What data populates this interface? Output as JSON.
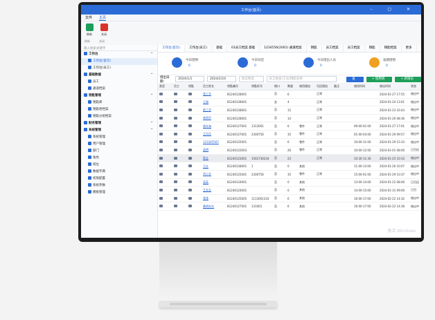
{
  "window": {
    "title": "工作台(首页)",
    "controls": "–  ▢  ✕"
  },
  "menu": [
    "文件",
    "主页"
  ],
  "ribbon": {
    "refresh": "刷新",
    "close": "关闭",
    "group1": "刷新",
    "group2": "关闭"
  },
  "sidebar": {
    "search": "输入搜索关键字",
    "items": [
      {
        "label": "工作台",
        "type": "head"
      },
      {
        "label": "工作台(首页)",
        "type": "sub",
        "selected": true
      },
      {
        "label": "工作台(员工)",
        "type": "sub"
      },
      {
        "label": "基础数据",
        "type": "head"
      },
      {
        "label": "员工",
        "type": "sub"
      },
      {
        "label": "通道档案",
        "type": "sub"
      },
      {
        "label": "钥匙管理",
        "type": "head"
      },
      {
        "label": "钥匙库",
        "type": "sub"
      },
      {
        "label": "钥匙柜档案",
        "type": "sub"
      },
      {
        "label": "钥匙分组档案",
        "type": "sub"
      },
      {
        "label": "财务管理",
        "type": "head"
      },
      {
        "label": "系统管理",
        "type": "head"
      },
      {
        "label": "系统管理",
        "type": "sub"
      },
      {
        "label": "用户管理",
        "type": "sub"
      },
      {
        "label": "部门",
        "type": "sub"
      },
      {
        "label": "角色",
        "type": "sub"
      },
      {
        "label": "岗位",
        "type": "sub"
      },
      {
        "label": "数据字典",
        "type": "sub"
      },
      {
        "label": "权限配置",
        "type": "sub"
      },
      {
        "label": "系统参数",
        "type": "sub"
      },
      {
        "label": "模板管理",
        "type": "sub"
      }
    ]
  },
  "tabs": [
    "工作台(首页)",
    "工作台(员工)",
    "基础",
    "01员工档案 基础",
    "1234556(2001) 通道档案",
    "钥匙",
    "员工档案",
    "员工档案",
    "钥匙",
    "钥匙档案",
    "更多"
  ],
  "stats": [
    {
      "label": "今日借钥",
      "value": "6",
      "color": "#2b6bd6"
    },
    {
      "label": "今日归还",
      "value": "0",
      "color": "#2b6bd6"
    },
    {
      "label": "今日借出人员",
      "value": "0",
      "color": "#2b6bd6"
    },
    {
      "label": "逾期借钥",
      "value": "0",
      "color": "#f0a020"
    }
  ],
  "filter": {
    "label": "借出日期:",
    "from": "2024/1/1",
    "to": "2024/2/24",
    "status_ph": "状态筛选",
    "search_ph": "员工姓名/工号/钥匙名称",
    "query": "查询",
    "borrow": "+ 借用钥匙",
    "add": "+ 新增员工"
  },
  "table": {
    "headers": [
      "类型",
      "员工",
      "钥匙",
      "员工姓名",
      "钥匙编号",
      "钥匙柜号",
      "格口",
      "数量",
      "借用理由",
      "归还理由",
      "备注",
      "借用时间",
      "借出时间",
      "状态"
    ],
    "rows": [
      [
        "",
        "",
        "",
        "张三丰",
        "B1240128001",
        "",
        "否",
        "6",
        "",
        "正常",
        "",
        "",
        "2024-01-27 17:55",
        "借出中"
      ],
      [
        "",
        "",
        "",
        "王刚",
        "B1240128001",
        "",
        "女",
        "4",
        "",
        "正常",
        "",
        "",
        "2024-01-24 13:01",
        "借出中"
      ],
      [
        "",
        "",
        "",
        "赵三丰",
        "B1240128001",
        "",
        "否",
        "15",
        "",
        "正常",
        "",
        "",
        "2024-01-23 16:43",
        "借出中"
      ],
      [
        "",
        "",
        "",
        "李四平",
        "B1240128001",
        "",
        "否",
        "14",
        "",
        "正常",
        "",
        "",
        "2024-01-20 08:36",
        "借出中"
      ],
      [
        "",
        "",
        "",
        "周东海",
        "B1240127001",
        "1313001",
        "否",
        "6",
        "零件",
        "正常",
        "",
        "09:00-01:00",
        "2024-01-27 17:01",
        "借出中"
      ],
      [
        "",
        "",
        "",
        "王乐乐",
        "B1240127001",
        "2300756",
        "否",
        "35",
        "零件",
        "正常",
        "",
        "01:00-03:00",
        "2024-01-29 09:57",
        "借出中"
      ],
      [
        "",
        "",
        "",
        "123345567",
        "B1240125001",
        "",
        "否",
        "6",
        "零件",
        "正常",
        "",
        "10:00-11:00",
        "2024-01-29 15:33",
        "借出中"
      ],
      [
        "",
        "",
        "",
        "英明",
        "B1240122003",
        "",
        "否",
        "26",
        "零件",
        "正常",
        "",
        "10:00-12:00",
        "2024-01-01 08:00",
        "已归还"
      ],
      [
        "",
        "",
        "",
        "陈五",
        "B1240123001",
        "1561736234",
        "否",
        "23",
        "",
        "正常",
        "",
        "10:30-11:30",
        "2024-01-25 10:33",
        "借出中"
      ],
      [
        "",
        "",
        "",
        "王红",
        "B1240128001",
        "1",
        "否",
        "0",
        "其他",
        "",
        "",
        "11:00-13:00",
        "2024-01-26 10:07",
        "借出中"
      ],
      [
        "",
        "",
        "",
        "刘二丰",
        "B1240125001",
        "2300756",
        "否",
        "35",
        "零件",
        "正常",
        "",
        "15:00-01:00",
        "2024-01-29 10:37",
        "借出中"
      ],
      [
        "",
        "",
        "",
        "英英",
        "B1240124001",
        "",
        "否",
        "0",
        "其他",
        "",
        "",
        "13:00-14:00",
        "2024-01-22 08:00",
        "已归还"
      ],
      [
        "",
        "",
        "",
        "王五五",
        "B1240124001",
        "",
        "否",
        "0",
        "其他",
        "",
        "",
        "14:00-15:00",
        "2024-01-31 09:00",
        "已归"
      ],
      [
        "",
        "",
        "",
        "张张",
        "B1240125005",
        "1113001333",
        "否",
        "6",
        "其他",
        "",
        "",
        "16:00-17:00",
        "2024-02-22 14:32",
        "借出中"
      ],
      [
        "",
        "",
        "",
        "黄明东东",
        "B1240127001",
        "131001",
        "否",
        "6",
        "其他",
        "",
        "",
        "16:00-17:00",
        "2024-02-22 14:36",
        "借出中"
      ]
    ]
  },
  "watermark": "激活 Windows"
}
